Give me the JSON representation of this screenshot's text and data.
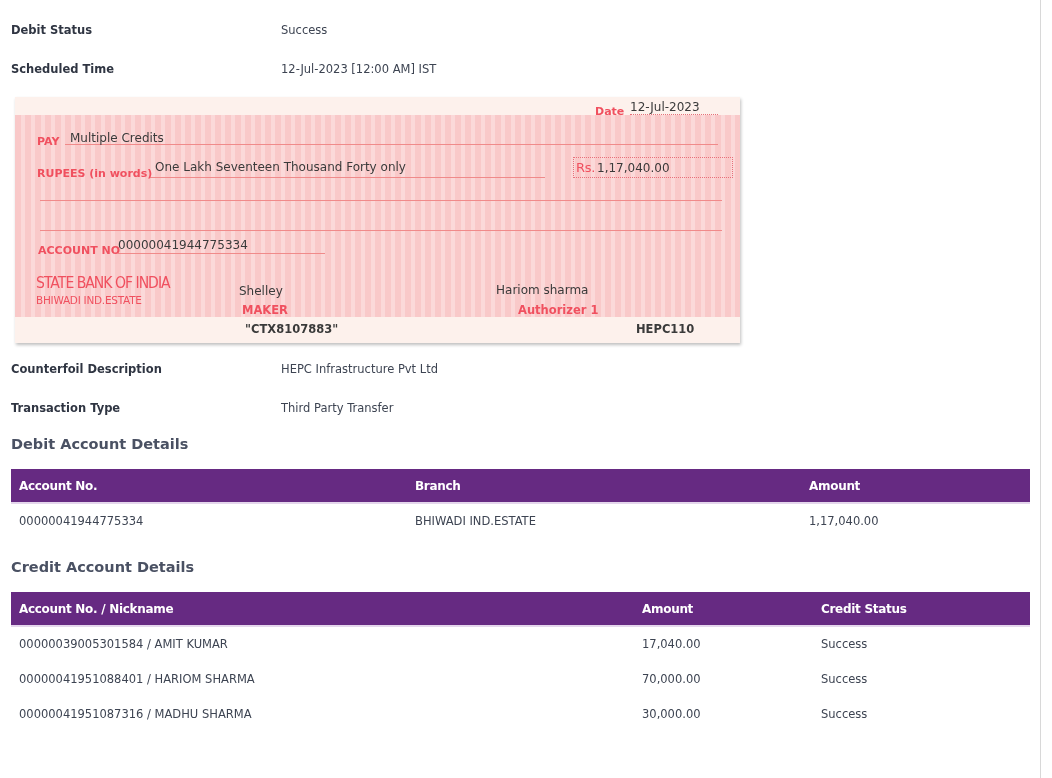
{
  "fields_top": [
    {
      "label": "Debit Status",
      "value": "Success"
    },
    {
      "label": "Scheduled Time",
      "value": "12-Jul-2023 [12:00 AM] IST"
    }
  ],
  "cheque": {
    "date_label": "Date",
    "date": "12-Jul-2023",
    "pay_label": "PAY",
    "payee": "Multiple Credits",
    "rupees_label": "RUPEES (in words)",
    "amount_words": "One Lakh Seventeen Thousand Forty only",
    "currency_label": "Rs.",
    "amount": "1,17,040.00",
    "account_label": "ACCOUNT NO",
    "account_no": "00000041944775334",
    "bank_name": "STATE BANK OF INDIA",
    "branch": "BHIWADI IND.ESTATE",
    "maker_name": "Shelley",
    "maker_label": "MAKER",
    "authorizer_name": "Hariom sharma",
    "authorizer_label": "Authorizer 1",
    "reference": "\"CTX8107883\"",
    "code": "HEPC110"
  },
  "fields_bottom": [
    {
      "label": "Counterfoil Description",
      "value": "HEPC Infrastructure Pvt Ltd"
    },
    {
      "label": "Transaction Type",
      "value": "Third Party Transfer"
    }
  ],
  "debit_section": {
    "title": "Debit Account Details",
    "columns": [
      "Account No.",
      "Branch",
      "Amount"
    ],
    "rows": [
      [
        "00000041944775334",
        "BHIWADI IND.ESTATE",
        "1,17,040.00"
      ]
    ]
  },
  "credit_section": {
    "title": "Credit Account Details",
    "columns": [
      "Account No. / Nickname",
      "Amount",
      "Credit Status"
    ],
    "rows": [
      [
        "00000039005301584 / AMIT KUMAR",
        "17,040.00",
        "Success"
      ],
      [
        "00000041951088401 / HARIOM SHARMA",
        "70,000.00",
        "Success"
      ],
      [
        "00000041951087316 / MADHU SHARMA",
        "30,000.00",
        "Success"
      ]
    ]
  }
}
